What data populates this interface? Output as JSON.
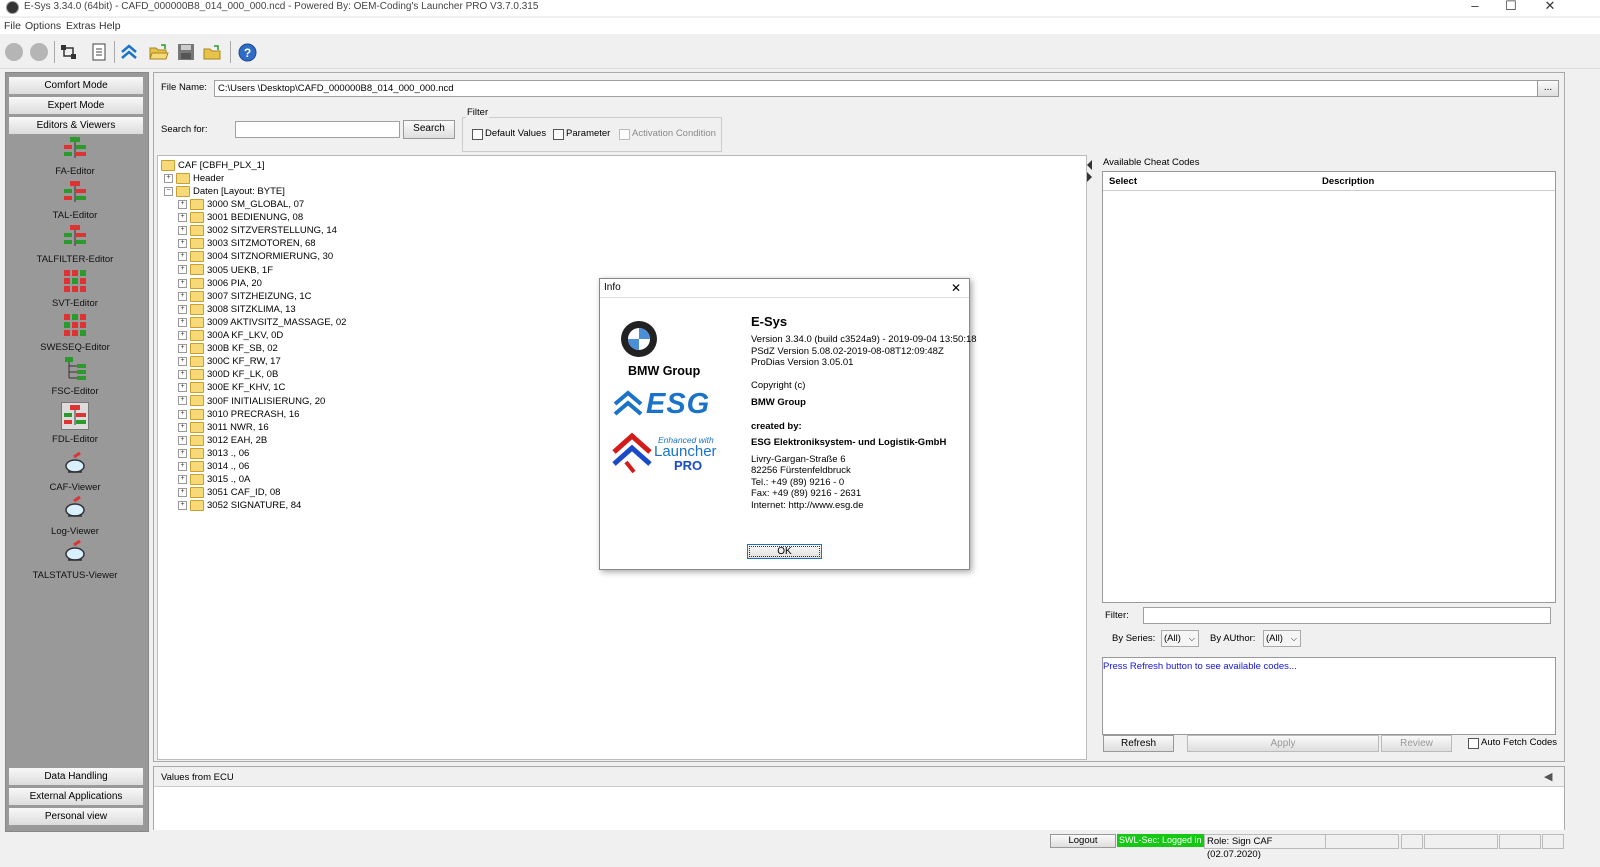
{
  "window": {
    "title": "E-Sys 3.34.0  (64bit) - CAFD_000000B8_014_000_000.ncd  - Powered By: OEM-Coding's Launcher PRO V3.7.0.315",
    "minimize": "–",
    "maximize": "☐",
    "close": "✕"
  },
  "menu": [
    "File",
    "Options",
    "Extras",
    "Help"
  ],
  "toolbar": {
    "icons": [
      "back-icon",
      "forward-icon",
      "connect-icon",
      "document-icon",
      "esg-icon",
      "open-folder-icon",
      "save-icon",
      "open-file-icon",
      "help-icon"
    ],
    "help_glyph": "?"
  },
  "left_panel": {
    "top_buttons": [
      "Comfort Mode",
      "Expert Mode",
      "Editors & Viewers"
    ],
    "tools": [
      "FA-Editor",
      "TAL-Editor",
      "TALFILTER-Editor",
      "SVT-Editor",
      "SWESEQ-Editor",
      "FSC-Editor",
      "FDL-Editor",
      "CAF-Viewer",
      "Log-Viewer",
      "TALSTATUS-Viewer"
    ],
    "bottom_buttons": [
      "Data Handling",
      "External Applications",
      "Personal view"
    ]
  },
  "file": {
    "label": "File Name:",
    "value": "C:\\Users           \\Desktop\\CAFD_000000B8_014_000_000.ncd",
    "browse": "..."
  },
  "search": {
    "label": "Search for:",
    "value": "",
    "button": "Search"
  },
  "filter": {
    "title": "Filter",
    "default_values": "Default Values",
    "parameter": "Parameter",
    "activation_condition": "Activation Condition"
  },
  "tree": {
    "root": "CAF [CBFH_PLX_1]",
    "header": "Header",
    "daten": "Daten [Layout: BYTE]",
    "items": [
      "3000 SM_GLOBAL, 07",
      "3001 BEDIENUNG, 08",
      "3002 SITZVERSTELLUNG, 14",
      "3003 SITZMOTOREN, 68",
      "3004 SITZNORMIERUNG, 30",
      "3005 UEKB, 1F",
      "3006 PIA, 20",
      "3007 SITZHEIZUNG, 1C",
      "3008 SITZKLIMA, 13",
      "3009 AKTIVSITZ_MASSAGE, 02",
      "300A KF_LKV, 0D",
      "300B KF_SB, 02",
      "300C KF_RW, 17",
      "300D KF_LK, 0B",
      "300E KF_KHV, 1C",
      "300F INITIALISIERUNG, 20",
      "3010 PRECRASH, 16",
      "3011 NWR, 16",
      "3012 EAH, 2B",
      "3013 ., 06",
      "3014 ., 06",
      "3015 ., 0A",
      "3051 CAF_ID, 08",
      "3052 SIGNATURE, 84"
    ]
  },
  "cheat": {
    "title": "Available Cheat Codes",
    "col_select": "Select",
    "col_description": "Description",
    "filter_label": "Filter:",
    "filter_value": "",
    "series_label": "By Series:",
    "series_value": "(All)",
    "author_label": "By AUthor:",
    "author_value": "(All)",
    "message": "Press Refresh button to see available codes...",
    "refresh": "Refresh",
    "apply": "Apply",
    "review": "Review",
    "auto_fetch": "Auto Fetch Codes"
  },
  "values": {
    "title": "Values from ECU"
  },
  "status": {
    "logout": "Logout",
    "swl": "SWL-Sec: Logged in",
    "role": "Role: Sign CAF (02.07.2020)"
  },
  "dialog": {
    "title": "Info",
    "close": "✕",
    "company": "BMW Group",
    "esg_logo": "ESG",
    "launcher_small": "Enhanced with",
    "launcher_big": "Launcher",
    "launcher_pro": "PRO",
    "product": "E-Sys",
    "version": "Version 3.34.0 (build c3524a9) - 2019-09-04 13:50:18",
    "psdz": "PSdZ Version 5.08.02-2019-08-08T12:09:48Z",
    "prodias": "ProDias Version 3.05.01",
    "copyright": "Copyright (c)",
    "copyright_holder": "BMW Group",
    "created_by": "created by:",
    "creator": "ESG Elektroniksystem- und Logistik-GmbH",
    "street": "Livry-Gargan-Straße 6",
    "city": "82256 Fürstenfeldbruck",
    "tel": "Tel.: +49 (89) 9216 - 0",
    "fax": "Fax: +49 (89) 9216 - 2631",
    "internet": "Internet: http://www.esg.de",
    "ok": "OK"
  },
  "colors": {
    "accent_blue": "#1a73c8",
    "launcher_red": "#d31b1b",
    "status_green": "#14c814"
  }
}
